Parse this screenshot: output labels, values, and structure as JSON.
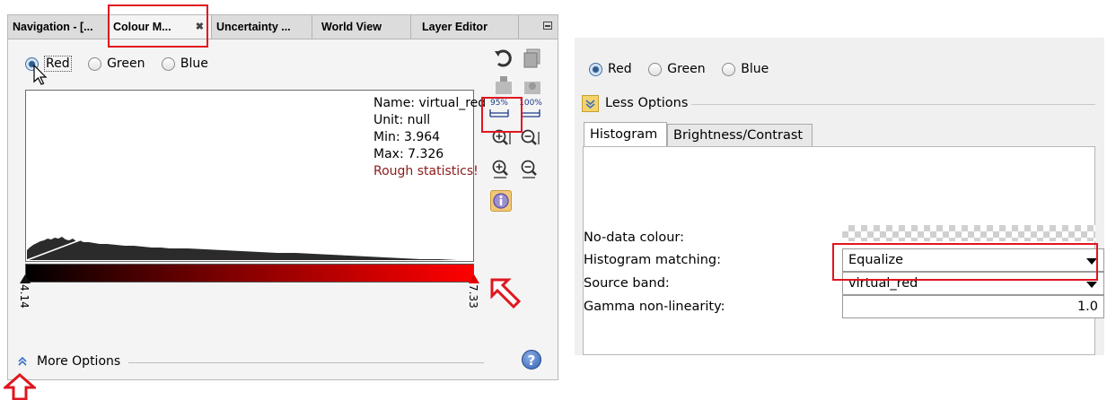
{
  "left": {
    "tabs": [
      {
        "label": "Navigation - [...",
        "active": false
      },
      {
        "label": "Colour M...",
        "active": true,
        "close_glyph": "✖"
      },
      {
        "label": "Uncertainty ...",
        "active": false
      },
      {
        "label": "World View",
        "active": false
      },
      {
        "label": "Layer Editor",
        "active": false
      }
    ],
    "bands": {
      "red": "Red",
      "green": "Green",
      "blue": "Blue",
      "selected": "red"
    },
    "stats": {
      "name": "Name: virtual_red",
      "unit": "Unit: null",
      "min": "Min: 3.964",
      "max": "Max: 7.326",
      "warning": "Rough statistics!"
    },
    "slider_min": "4.14",
    "slider_max": "7.33",
    "zoom_labels": {
      "pct95": "95%",
      "pct100": "100%"
    },
    "more_options": "More Options",
    "help_glyph": "?"
  },
  "right": {
    "bands": {
      "red": "Red",
      "green": "Green",
      "blue": "Blue",
      "selected": "red"
    },
    "less_options": "Less Options",
    "tabs": [
      {
        "label": "Histogram",
        "active": true
      },
      {
        "label": "Brightness/Contrast",
        "active": false
      }
    ],
    "props": {
      "nodata_label": "No-data colour:",
      "hist_matching_label": "Histogram matching:",
      "hist_matching_value": "Equalize",
      "source_band_label": "Source band:",
      "source_band_value": "virtual_red",
      "gamma_label": "Gamma non-linearity:",
      "gamma_value": "1.0"
    }
  },
  "colors": {
    "annotation": "#e0161e",
    "warning_text": "#8b1a1a",
    "accent": "#2d5b8e"
  }
}
